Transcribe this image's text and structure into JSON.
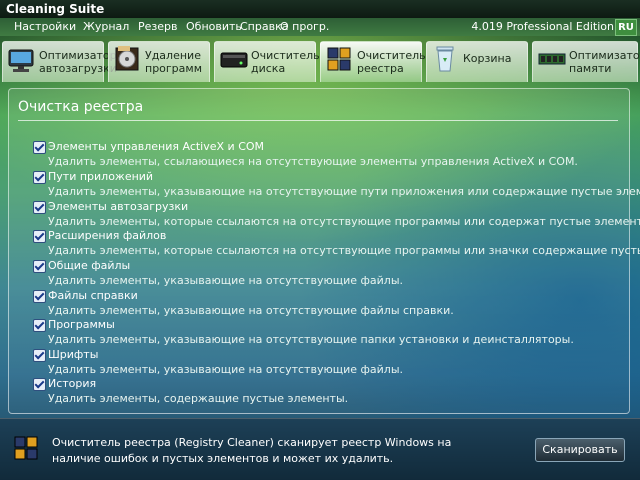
{
  "window": {
    "title": "Cleaning Suite"
  },
  "menu": {
    "items": [
      "Настройки",
      "Журнал",
      "Резерв",
      "Обновить",
      "Справка",
      "О прогр."
    ],
    "edition": "4.019 Professional Edition",
    "language": "RU"
  },
  "tabs": [
    {
      "line1": "Оптимизатор",
      "line2": "автозагрузки",
      "icon": "startup-optimizer-icon"
    },
    {
      "line1": "Удаление",
      "line2": "программ",
      "icon": "uninstall-programs-icon"
    },
    {
      "line1": "Очиститель",
      "line2": "диска",
      "icon": "disk-cleaner-icon"
    },
    {
      "line1": "Очиститель",
      "line2": "реестра",
      "icon": "registry-cleaner-icon"
    },
    {
      "line1": "Корзина",
      "line2": "",
      "icon": "recycle-bin-icon"
    },
    {
      "line1": "Оптимизатор",
      "line2": "памяти",
      "icon": "memory-optimizer-icon"
    }
  ],
  "active_tab": 3,
  "panel": {
    "title": "Очистка реестра",
    "options": [
      {
        "label": "Элементы управления ActiveX и COM",
        "description": "Удалить элементы, ссылающиеся на отсутствующие элементы управления ActiveX и COM.",
        "checked": true
      },
      {
        "label": "Пути приложений",
        "description": "Удалить элементы, указывающие на отсутствующие пути приложения или содержащие пустые элементы.",
        "checked": true
      },
      {
        "label": "Элементы автозагрузки",
        "description": "Удалить элементы, которые ссылаются на отсутствующие программы или содержат пустые элементы.",
        "checked": true
      },
      {
        "label": "Расширения файлов",
        "description": "Удалить элементы, которые ссылаются на отсутствующие программы или значки содержащие пустые элементы.",
        "checked": true
      },
      {
        "label": "Общие файлы",
        "description": "Удалить элементы, указывающие на отсутствующие файлы.",
        "checked": true
      },
      {
        "label": "Файлы справки",
        "description": "Удалить элементы, указывающие на отсутствующие файлы справки.",
        "checked": true
      },
      {
        "label": "Программы",
        "description": "Удалить элементы, указывающие на отсутствующие папки установки и деинсталляторы.",
        "checked": true
      },
      {
        "label": "Шрифты",
        "description": "Удалить элементы, указывающие на отсутствующие файлы.",
        "checked": true
      },
      {
        "label": "История",
        "description": "Удалить элементы, содержащие пустые элементы.",
        "checked": true
      }
    ]
  },
  "footer": {
    "line1": "Очиститель реестра (Registry Cleaner) сканирует реестр Windows на",
    "line2": "наличие ошибок и пустых элементов и может их удалить.",
    "scan_button": "Сканировать"
  }
}
